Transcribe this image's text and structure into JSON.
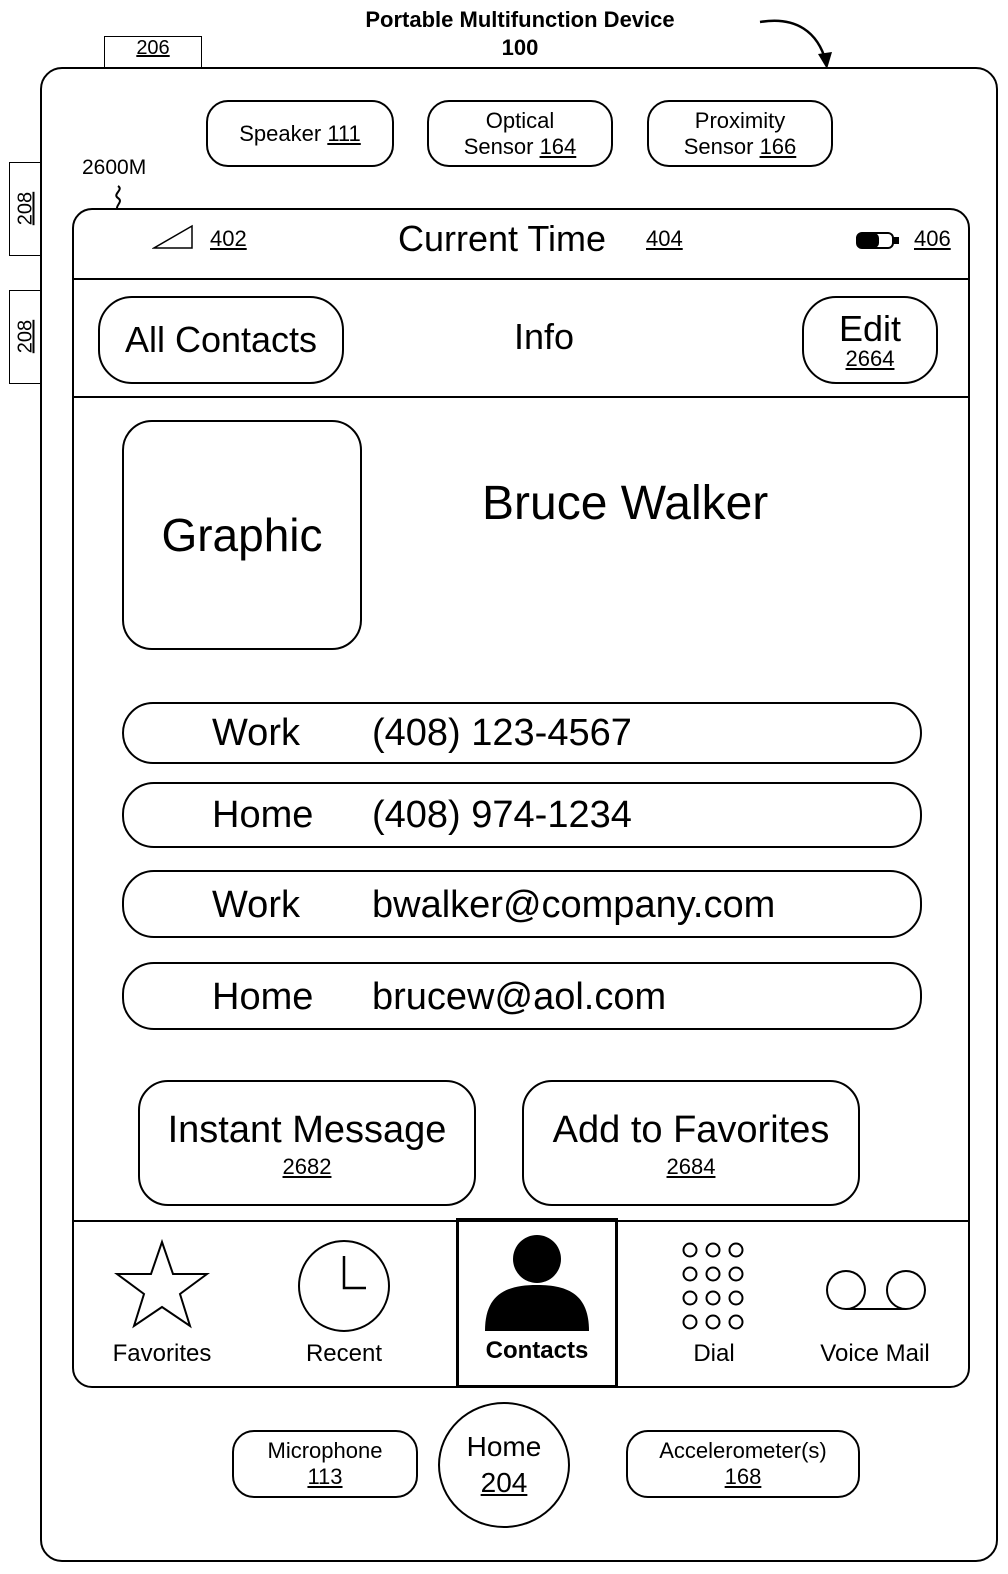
{
  "device": {
    "title": "Portable Multifunction Device",
    "number": "100",
    "ref_206": "206",
    "ref_208a": "208",
    "ref_208b": "208",
    "screen_ref": "2600M",
    "speaker": {
      "label": "Speaker",
      "num": "111"
    },
    "optical": {
      "line1": "Optical",
      "line2": "Sensor",
      "num": "164"
    },
    "proximity": {
      "line1": "Proximity",
      "line2": "Sensor",
      "num": "166"
    },
    "microphone": {
      "label": "Microphone",
      "num": "113"
    },
    "home": {
      "label": "Home",
      "num": "204"
    },
    "accelerometer": {
      "label": "Accelerometer(s)",
      "num": "168"
    }
  },
  "statusbar": {
    "signal_ref": "402",
    "time": "Current Time",
    "time_ref": "404",
    "battery_ref": "406",
    "icons": [
      "signal-icon",
      "battery-icon"
    ]
  },
  "navbar": {
    "back_label": "All Contacts",
    "title": "Info",
    "edit_label": "Edit",
    "edit_ref": "2664"
  },
  "contact": {
    "graphic_label": "Graphic",
    "name": "Bruce Walker",
    "fields": [
      {
        "label": "Work",
        "value": "(408) 123-4567"
      },
      {
        "label": "Home",
        "value": "(408) 974-1234"
      },
      {
        "label": "Work",
        "value": "bwalker@company.com"
      },
      {
        "label": "Home",
        "value": "brucew@aol.com"
      }
    ],
    "instant_message": {
      "label": "Instant Message",
      "ref": "2682"
    },
    "add_favorites": {
      "label": "Add to Favorites",
      "ref": "2684"
    }
  },
  "tabs": [
    {
      "label": "Favorites",
      "icon": "star-icon"
    },
    {
      "label": "Recent",
      "icon": "clock-icon"
    },
    {
      "label": "Contacts",
      "icon": "person-icon",
      "selected": true
    },
    {
      "label": "Dial",
      "icon": "keypad-icon"
    },
    {
      "label": "Voice Mail",
      "icon": "voicemail-icon"
    }
  ]
}
